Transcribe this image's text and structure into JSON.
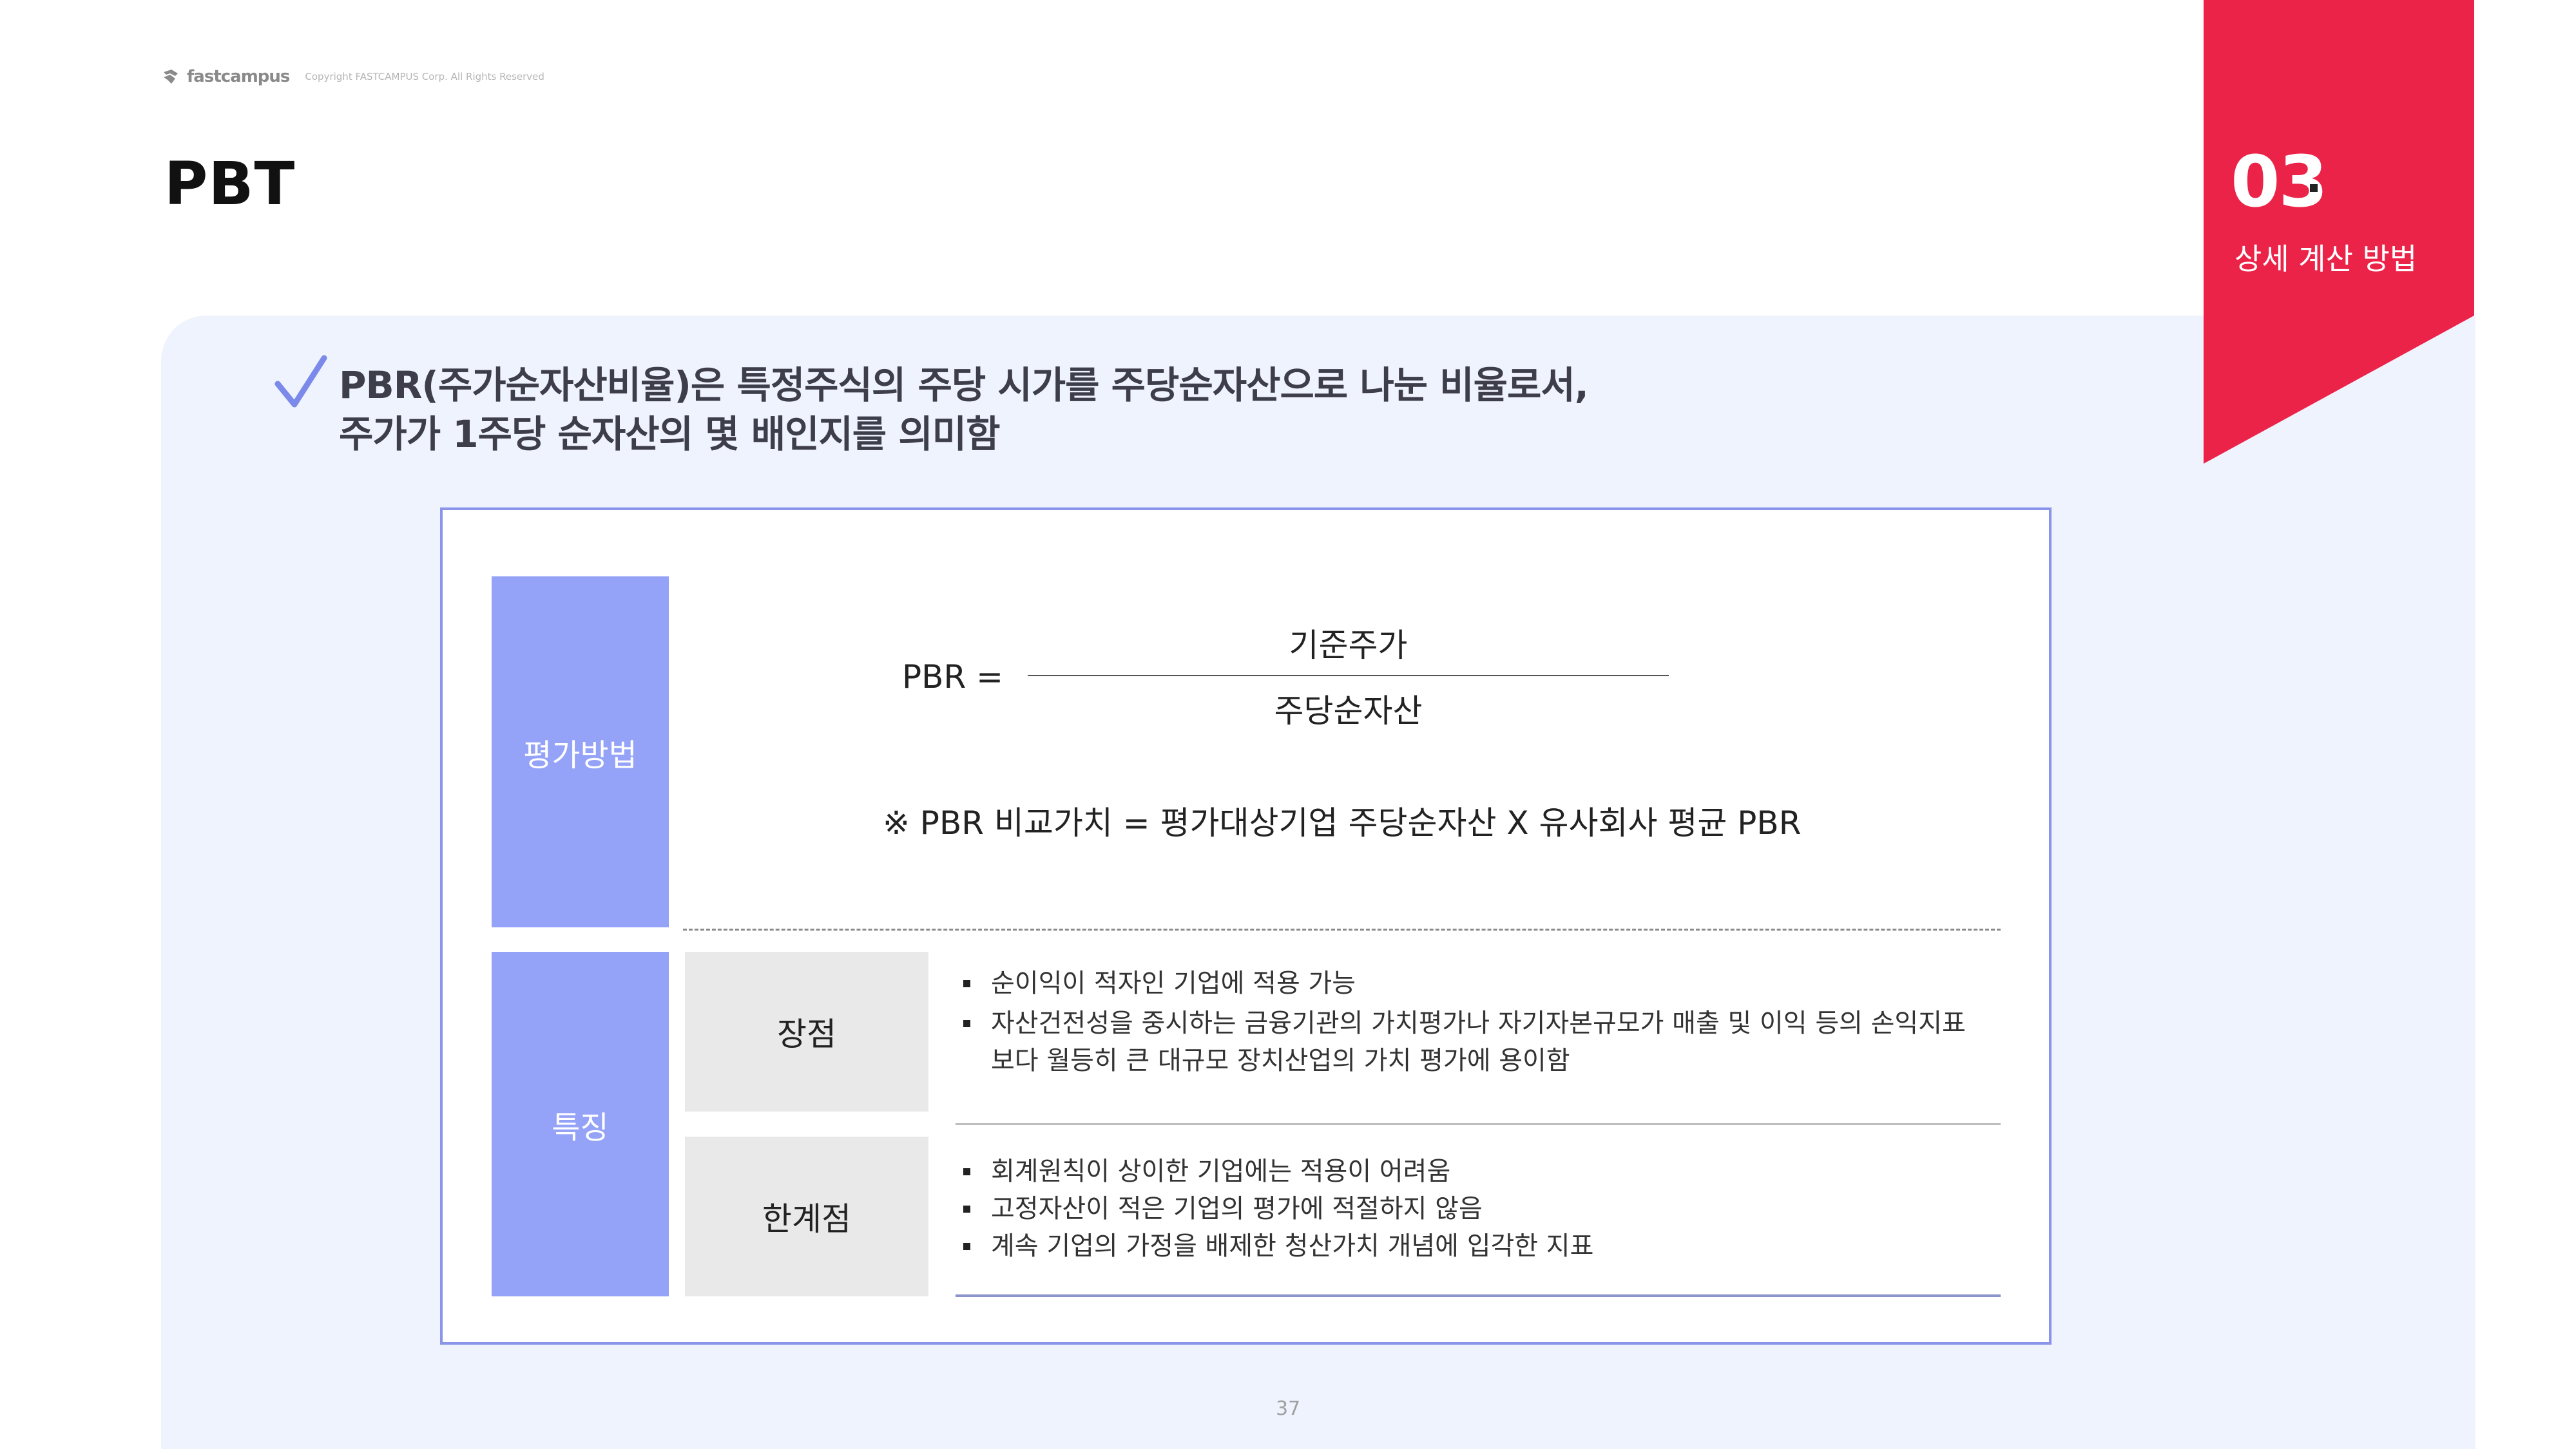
{
  "header": {
    "logo_text": "fastcampus",
    "copyright": "Copyright FASTCAMPUS Corp. All Rights Reserved",
    "title": "PBT"
  },
  "section": {
    "number": "03",
    "subtitle": "상세 계산 방법",
    "color": "#ec2348"
  },
  "statement": {
    "line1": "PBR(주가순자산비율)은 특정주식의 주당 시가를 주당순자산으로 나눈 비율로서,",
    "line2": "주가가 1주당 순자산의 몇 배인지를 의미함",
    "check_color": "#7b89ea"
  },
  "evaluation": {
    "label": "평가방법",
    "formula_lhs": "PBR =",
    "numerator": "기준주가",
    "denominator": "주당순자산",
    "note": "※ PBR 비교가치  = 평가대상기업 주당순자산 X 유사회사 평균 PBR"
  },
  "features": {
    "label": "특징",
    "advantages": {
      "label": "장점",
      "items": [
        "순이익이 적자인 기업에 적용 가능",
        "자산건전성을 중시하는 금융기관의 가치평가나 자기자본규모가 매출 및 이익 등의 손익지표",
        "보다 월등히 큰 대규모 장치산업의 가치 평가에 용이함"
      ]
    },
    "limitations": {
      "label": "한계점",
      "items": [
        "회계원칙이 상이한 기업에는 적용이 어려움",
        "고정자산이 적은 기업의 평가에 적절하지 않음",
        "계속 기업의 가정을 배제한 청산가치 개념에 입각한 지표"
      ]
    }
  },
  "page_number": "37",
  "colors": {
    "panel": "#eff3fd",
    "label_blue": "#94a2f7",
    "label_gray": "#e9e9e9",
    "box_border": "#8a94ea"
  }
}
